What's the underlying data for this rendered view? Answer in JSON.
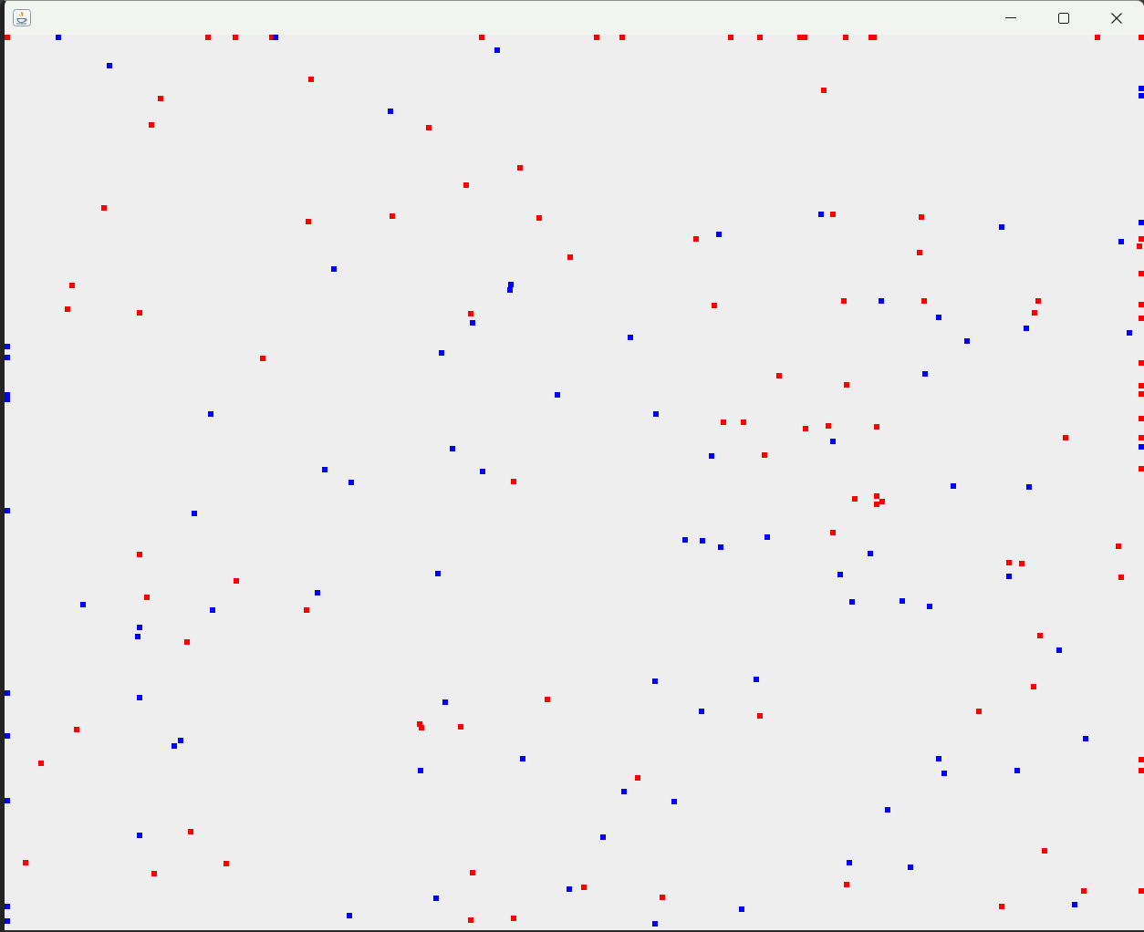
{
  "window": {
    "canvas": {
      "series": [
        {
          "color": "#ff0000"
        },
        {
          "color": "#0000ff"
        }
      ]
    }
  }
}
